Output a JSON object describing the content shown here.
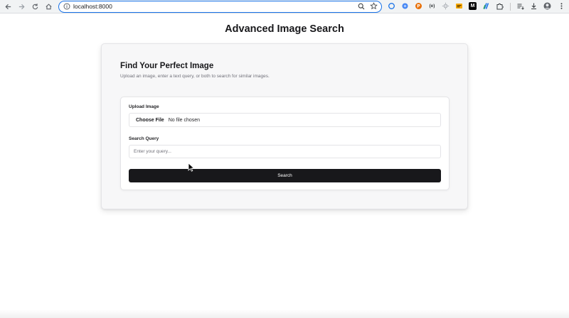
{
  "browser": {
    "url": "localhost:8000",
    "extensions": [
      {
        "icon": "circle-outline-extension-icon",
        "color": "#1a73e8"
      },
      {
        "icon": "blue-dot-extension-icon",
        "color": "#4285f4"
      },
      {
        "icon": "orange-badge-extension-icon",
        "color": "#e8710a"
      },
      {
        "icon": "brackets-extension-icon",
        "color": "#3c4043",
        "text": "(e)"
      },
      {
        "icon": "sun-extension-icon",
        "color": "#9aa0a6"
      },
      {
        "icon": "yellow-box-extension-icon",
        "color": "#f9ab00"
      },
      {
        "icon": "m-logo-extension-icon",
        "color": "#000000",
        "text": "M"
      },
      {
        "icon": "stripes-extension-icon",
        "color": "#1a73e8"
      },
      {
        "icon": "puzzle-icon",
        "color": "#3c4043"
      }
    ]
  },
  "page": {
    "title": "Advanced Image Search"
  },
  "card": {
    "heading": "Find Your Perfect Image",
    "subtitle": "Upload an image, enter a text query, or both to search for similar images."
  },
  "form": {
    "upload_label": "Upload Image",
    "choose_file_label": "Choose File",
    "no_file_text": "No file chosen",
    "query_label": "Search Query",
    "query_placeholder": "Enter your query...",
    "query_value": "",
    "search_button_label": "Search"
  },
  "colors": {
    "primary_button": "#18181b",
    "omnibox_focus": "#1a73e8",
    "muted_text": "#71717a"
  }
}
